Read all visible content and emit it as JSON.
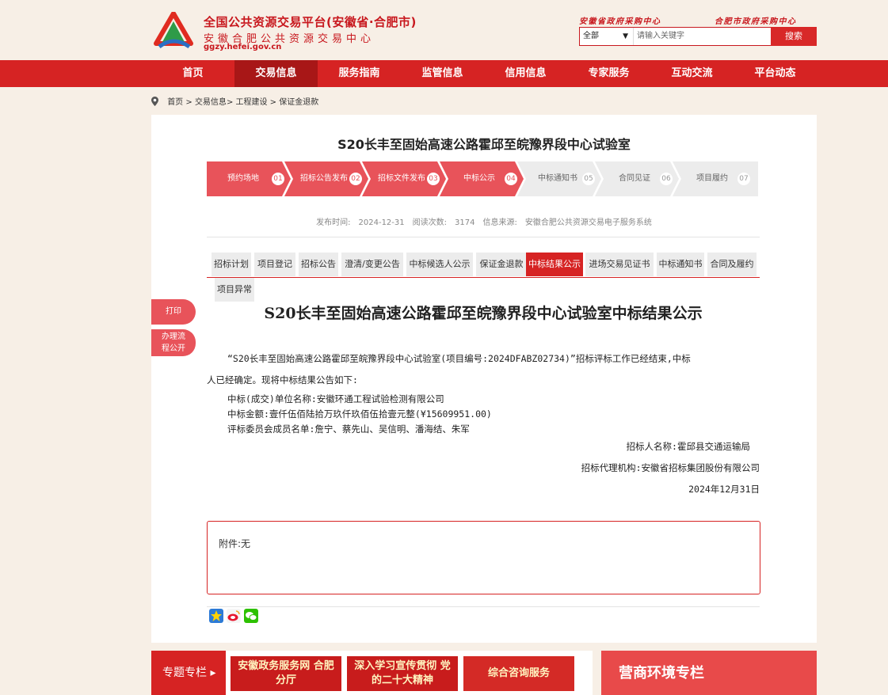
{
  "header": {
    "title": "全国公共资源交易平台(安徽省·合肥市)",
    "subtitle": "安徽合肥公共资源交易中心",
    "url": "ggzy.hefei.gov.cn",
    "link_province": "安徽省政府采购中心",
    "link_city": "合肥市政府采购中心",
    "search": {
      "scope": "全部",
      "placeholder": "请输入关键字",
      "button": "搜索"
    }
  },
  "nav": {
    "items": [
      "首页",
      "交易信息",
      "服务指南",
      "监管信息",
      "信用信息",
      "专家服务",
      "互动交流",
      "平台动态"
    ],
    "active": "交易信息"
  },
  "breadcrumb": {
    "home": "首页",
    "l1": "交易信息",
    "l2": "工程建设",
    "l3": "保证金退款"
  },
  "project": {
    "title": "S20长丰至固始高速公路霍邱至皖豫界段中心试验室",
    "steps": [
      {
        "label": "预约场地",
        "num": "01"
      },
      {
        "label": "招标公告发布",
        "num": "02"
      },
      {
        "label": "招标文件发布",
        "num": "03"
      },
      {
        "label": "中标公示",
        "num": "04"
      },
      {
        "label": "中标通知书",
        "num": "05"
      },
      {
        "label": "合同见证",
        "num": "06"
      },
      {
        "label": "项目履约",
        "num": "07"
      }
    ],
    "meta": {
      "date_label": "发布时间:",
      "date": "2024-12-31",
      "views_label": "阅读次数:",
      "views": "3174",
      "source_label": "信息来源:",
      "source": "安徽合肥公共资源交易电子服务系统"
    }
  },
  "tabs": {
    "items": [
      "招标计划",
      "项目登记",
      "招标公告",
      "澄清/变更公告",
      "中标候选人公示",
      "保证金退款",
      "中标结果公示",
      "进场交易见证书",
      "中标通知书",
      "合同及履约",
      "项目异常"
    ],
    "active": "中标结果公示"
  },
  "side": {
    "print": "打印",
    "process_l1": "办理流",
    "process_l2": "程公开"
  },
  "announcement": {
    "title": "S20长丰至固始高速公路霍邱至皖豫界段中心试验室中标结果公示",
    "para_line1": "“S20长丰至固始高速公路霍邱至皖豫界段中心试验室(项目编号:2024DFABZ02734)”招标评标工作已经结束,中标",
    "para_line2": "人已经确定。现将中标结果公告如下:",
    "winner": "中标(成交)单位名称:安徽环通工程试验检测有限公司",
    "amount": "中标金额:壹仟伍佰陆拾万玖仟玖佰伍拾壹元整(¥15609951.00)",
    "committee": "评标委员会成员名单:詹宁、蔡先山、吴信明、潘海结、朱军",
    "tenderer": "招标人名称:霍邱县交通运输局",
    "agency": "招标代理机构:安徽省招标集团股份有限公司",
    "date": "2024年12月31日"
  },
  "attachment": "附件:无",
  "bottom": {
    "topic_label": "专题专栏",
    "banner1": "安徽政务服务网 合肥分厅",
    "banner2": "深入学习宣传贯彻 党的二十大精神",
    "banner3": "综合咨询服务",
    "business": "营商环境专栏"
  },
  "colors": {
    "brand_red": "#d62323",
    "step_active": "#e8535a",
    "step_inactive": "#ececec",
    "page_bg": "#f7efe6"
  }
}
